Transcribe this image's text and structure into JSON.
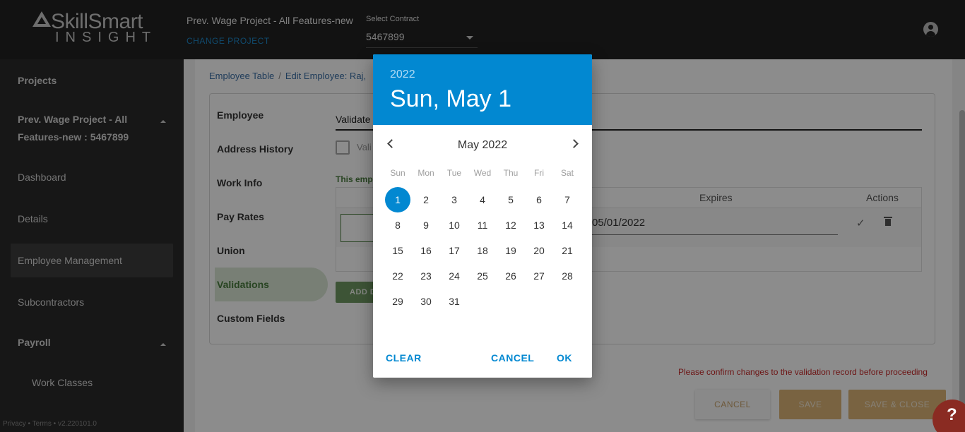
{
  "header": {
    "logo_main": "SkillSmart",
    "logo_sub": "INSIGHT",
    "project_title": "Prev. Wage Project - All Features-new",
    "change_project": "CHANGE PROJECT",
    "contract_label": "Select Contract",
    "contract_value": "5467899"
  },
  "sidebar": {
    "projects": "Projects",
    "project_line1": "Prev. Wage Project - All",
    "project_line2": "Features-new : 5467899",
    "dashboard": "Dashboard",
    "details": "Details",
    "employee_management": "Employee Management",
    "subcontractors": "Subcontractors",
    "payroll": "Payroll",
    "work_classes": "Work Classes",
    "footer": "Privacy • Terms • v2.220101.0"
  },
  "main": {
    "breadcrumb_1": "Employee Table",
    "breadcrumb_sep": "/",
    "breadcrumb_2": "Edit Employee: Raj,",
    "tabs": [
      "Employee",
      "Address History",
      "Work Info",
      "Pay Rates",
      "Union",
      "Validations",
      "Custom Fields"
    ],
    "employee_field": "Validate",
    "checkbox_label": "Vali",
    "green_note": "This emp",
    "table_headers": {
      "expires": "Expires",
      "actions": "Actions"
    },
    "expires_value": "05/01/2022",
    "add_button": "ADD D",
    "warning": "Please confirm changes to the validation record before proceeding",
    "cancel": "CANCEL",
    "save": "SAVE",
    "save_close": "SAVE & CLOSE"
  },
  "datepicker": {
    "year": "2022",
    "selected_date": "Sun, May 1",
    "month": "May 2022",
    "weekdays": [
      "Sun",
      "Mon",
      "Tue",
      "Wed",
      "Thu",
      "Fri",
      "Sat"
    ],
    "selected_day": 1,
    "days_in_month": 31,
    "first_weekday_index": 0,
    "clear": "CLEAR",
    "cancel": "CANCEL",
    "ok": "OK"
  },
  "help": {
    "label": "?"
  },
  "colors": {
    "accent": "#0288d1",
    "header_bg": "#212121",
    "sidebar_bg": "#2b2b2b",
    "save_button": "#dcb577",
    "warning": "#c62828",
    "validation_green": "#4a7d3e"
  },
  "icons": {
    "account": "account-circle-icon",
    "prev_month": "chevron-left-icon",
    "next_month": "chevron-right-icon",
    "confirm": "check-icon",
    "delete": "trash-icon"
  }
}
